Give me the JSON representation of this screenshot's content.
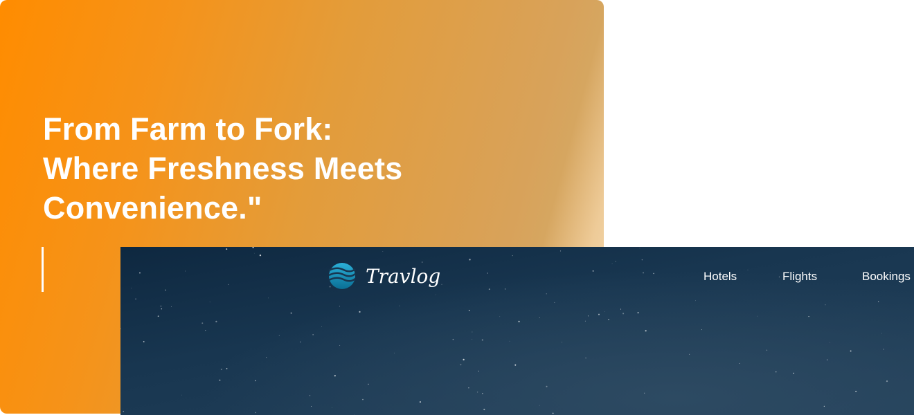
{
  "headline": {
    "lines": [
      "From Farm to Fork:",
      "Where Freshness Meets",
      "Convenience.\""
    ]
  },
  "site": {
    "logo_text": "Travlog",
    "nav": [
      "Hotels",
      "Flights",
      "Bookings"
    ]
  },
  "colors": {
    "accent": "#ff8c00",
    "hero_bg": "#183650"
  }
}
